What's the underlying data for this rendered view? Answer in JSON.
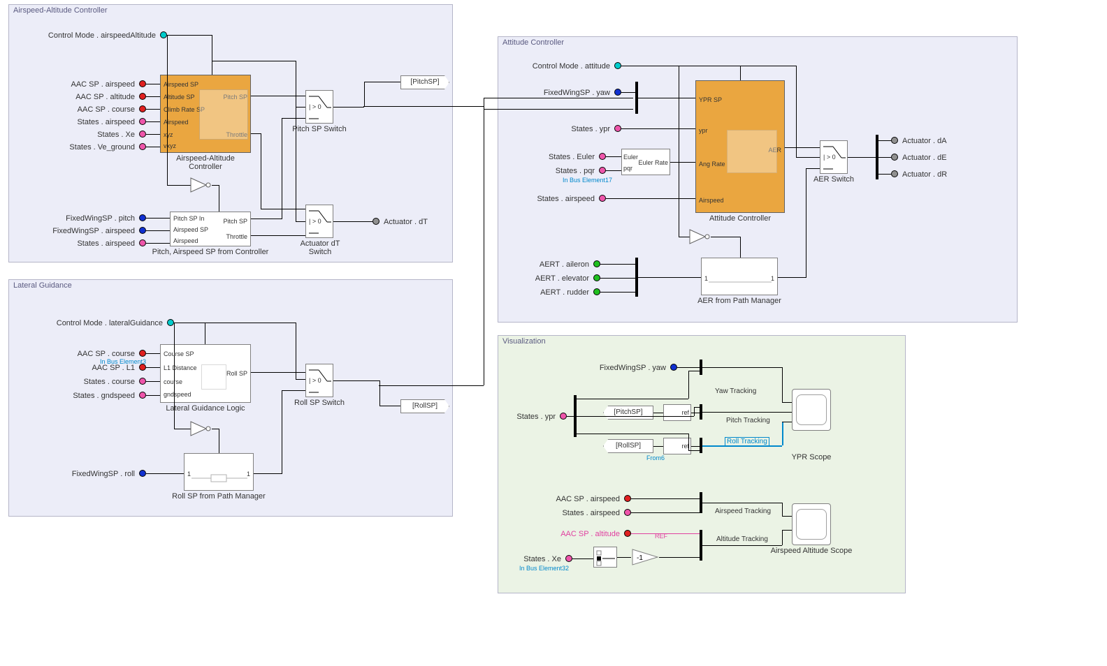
{
  "panels": {
    "aac": "Airspeed-Altitude Controller",
    "lat": "Lateral Guidance",
    "att": "Attitude Controller",
    "vis": "Visualization"
  },
  "aac": {
    "ports": {
      "mode": "Control Mode . airspeedAltitude",
      "airspeed_sp": "AAC SP . airspeed",
      "altitude_sp": "AAC SP . altitude",
      "course_sp": "AAC SP . course",
      "states_airspeed": "States . airspeed",
      "states_xe": "States . Xe",
      "states_ve": "States . Ve_ground",
      "fw_pitch": "FixedWingSP . pitch",
      "fw_airspeed": "FixedWingSP . airspeed",
      "states_airspeed2": "States . airspeed"
    },
    "block1": {
      "name": "Airspeed-Altitude Controller",
      "in": [
        "Airspeed SP",
        "Altitude SP",
        "Climb Rate SP",
        "Airspeed",
        "xyz",
        "vxyz"
      ],
      "out": [
        "Pitch SP",
        "Throttle"
      ]
    },
    "block2": {
      "name": "Pitch, Airspeed SP from Controller",
      "in": [
        "Pitch SP In",
        "Airspeed SP",
        "Airspeed"
      ],
      "out": [
        "Pitch SP",
        "Throttle"
      ]
    },
    "switch1": "Pitch SP Switch",
    "switch2": "Actuator dT Switch",
    "sw_label": "| > 0",
    "goto1": "[PitchSP]",
    "out_dT": "Actuator . dT"
  },
  "lat": {
    "ports": {
      "mode": "Control Mode . lateralGuidance",
      "course_sp": "AAC SP . course",
      "l1": "AAC SP . L1",
      "states_course": "States . course",
      "states_gnd": "States . gndspeed",
      "fw_roll": "FixedWingSP . roll"
    },
    "block1": {
      "name": "Lateral Guidance Logic",
      "in": [
        "Course SP",
        "L1 Distance",
        "course",
        "gndspeed"
      ],
      "out": [
        "Roll SP"
      ]
    },
    "block2": "Roll SP from Path Manager",
    "switch1": "Roll SP Switch",
    "sw_label": "| > 0",
    "goto1": "[RollSP]",
    "note_inbus3": "In Bus Element3"
  },
  "att": {
    "ports": {
      "mode": "Control Mode . attitude",
      "fw_yaw": "FixedWingSP . yaw",
      "states_ypr": "States . ypr",
      "states_euler": "States . Euler",
      "states_pqr": "States . pqr",
      "states_airspeed": "States . airspeed",
      "aert_ail": "AERT . aileron",
      "aert_elev": "AERT . elevator",
      "aert_rud": "AERT . rudder"
    },
    "note_inbus17": "In Bus Element17",
    "euler_block": {
      "in": [
        "Euler",
        "pqr"
      ],
      "out": "Euler Rate"
    },
    "block1": {
      "name": "Attitude Controller",
      "in": [
        "YPR SP",
        "ypr",
        "Ang Rate",
        "Airspeed"
      ],
      "out": "AER"
    },
    "block2": "AER from Path Manager",
    "switch1": "AER Switch",
    "sw_label": "| > 0",
    "out_dA": "Actuator . dA",
    "out_dE": "Actuator . dE",
    "out_dR": "Actuator . dR"
  },
  "vis": {
    "ports": {
      "fw_yaw": "FixedWingSP . yaw",
      "states_ypr": "States . ypr",
      "aac_airspeed": "AAC SP . airspeed",
      "states_airspeed": "States . airspeed",
      "aac_altitude": "AAC SP . altitude",
      "states_xe": "States . Xe"
    },
    "from_pitch": "[PitchSP]",
    "from_roll": "[RollSP]",
    "ref": "ref",
    "yaw_track": "Yaw Tracking",
    "pitch_track": "Pitch Tracking",
    "roll_track": "Roll Tracking",
    "airspeed_track": "Airspeed Tracking",
    "altitude_track": "Altitude Tracking",
    "scope1": "YPR Scope",
    "scope2": "Airspeed Altitude Scope",
    "gain": "-1",
    "note_ref": "REF",
    "note_from6": "From6",
    "note_inbus32": "In Bus Element32"
  }
}
